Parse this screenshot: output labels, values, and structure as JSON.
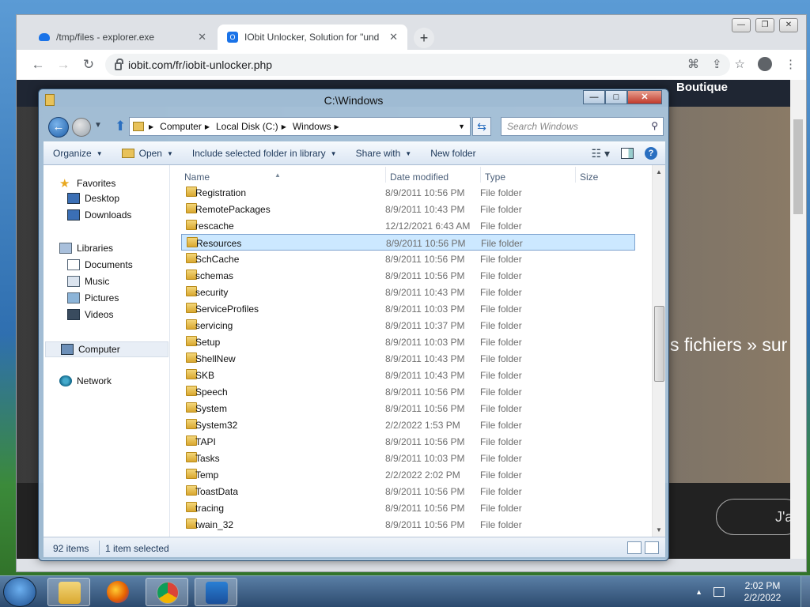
{
  "browser": {
    "tabs": [
      {
        "label": "/tmp/files - explorer.exe",
        "close": "✕"
      },
      {
        "label": "IObit Unlocker, Solution for \"und",
        "close": "✕"
      }
    ],
    "new_tab": "+",
    "url": "iobit.com/fr/iobit-unlocker.php",
    "page": {
      "nav_item": "Boutique",
      "hero_text": "s fichiers » sur",
      "button_text": "J'a"
    }
  },
  "explorer": {
    "title": "C:\\Windows",
    "breadcrumb": [
      "Computer",
      "Local Disk (C:)",
      "Windows"
    ],
    "search_placeholder": "Search Windows",
    "commands": {
      "organize": "Organize",
      "open": "Open",
      "include": "Include selected folder in library",
      "share": "Share with",
      "new_folder": "New folder"
    },
    "nav": {
      "favorites": "Favorites",
      "desktop": "Desktop",
      "downloads": "Downloads",
      "libraries": "Libraries",
      "documents": "Documents",
      "music": "Music",
      "pictures": "Pictures",
      "videos": "Videos",
      "computer": "Computer",
      "network": "Network"
    },
    "columns": {
      "name": "Name",
      "date": "Date modified",
      "type": "Type",
      "size": "Size"
    },
    "files": [
      {
        "name": "Registration",
        "date": "8/9/2011 10:56 PM",
        "type": "File folder"
      },
      {
        "name": "RemotePackages",
        "date": "8/9/2011 10:43 PM",
        "type": "File folder"
      },
      {
        "name": "rescache",
        "date": "12/12/2021 6:43 AM",
        "type": "File folder"
      },
      {
        "name": "Resources",
        "date": "8/9/2011 10:56 PM",
        "type": "File folder",
        "selected": true
      },
      {
        "name": "SchCache",
        "date": "8/9/2011 10:56 PM",
        "type": "File folder"
      },
      {
        "name": "schemas",
        "date": "8/9/2011 10:56 PM",
        "type": "File folder"
      },
      {
        "name": "security",
        "date": "8/9/2011 10:43 PM",
        "type": "File folder"
      },
      {
        "name": "ServiceProfiles",
        "date": "8/9/2011 10:03 PM",
        "type": "File folder"
      },
      {
        "name": "servicing",
        "date": "8/9/2011 10:37 PM",
        "type": "File folder"
      },
      {
        "name": "Setup",
        "date": "8/9/2011 10:03 PM",
        "type": "File folder"
      },
      {
        "name": "ShellNew",
        "date": "8/9/2011 10:43 PM",
        "type": "File folder"
      },
      {
        "name": "SKB",
        "date": "8/9/2011 10:43 PM",
        "type": "File folder"
      },
      {
        "name": "Speech",
        "date": "8/9/2011 10:56 PM",
        "type": "File folder"
      },
      {
        "name": "System",
        "date": "8/9/2011 10:56 PM",
        "type": "File folder"
      },
      {
        "name": "System32",
        "date": "2/2/2022 1:53 PM",
        "type": "File folder"
      },
      {
        "name": "TAPI",
        "date": "8/9/2011 10:56 PM",
        "type": "File folder"
      },
      {
        "name": "Tasks",
        "date": "8/9/2011 10:03 PM",
        "type": "File folder"
      },
      {
        "name": "Temp",
        "date": "2/2/2022 2:02 PM",
        "type": "File folder"
      },
      {
        "name": "ToastData",
        "date": "8/9/2011 10:56 PM",
        "type": "File folder"
      },
      {
        "name": "tracing",
        "date": "8/9/2011 10:56 PM",
        "type": "File folder"
      },
      {
        "name": "twain_32",
        "date": "8/9/2011 10:56 PM",
        "type": "File folder"
      }
    ],
    "status": {
      "count": "92 items",
      "selected": "1 item selected"
    }
  },
  "taskbar": {
    "clock_time": "2:02 PM",
    "clock_date": "2/2/2022"
  }
}
